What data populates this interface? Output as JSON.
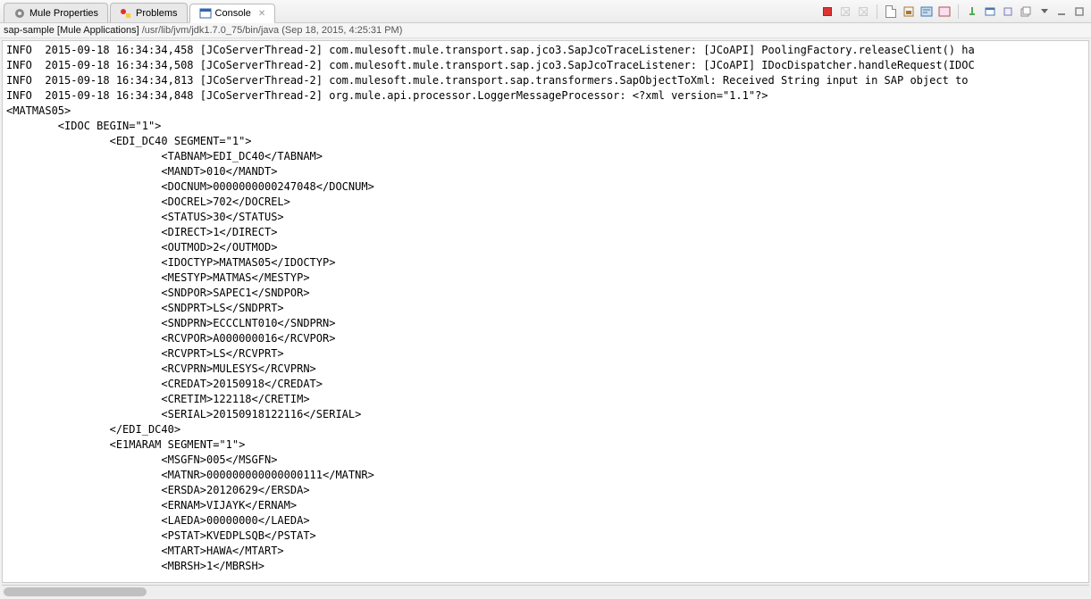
{
  "tabs": [
    {
      "label": "Mule Properties",
      "icon": "gear"
    },
    {
      "label": "Problems",
      "icon": "problems"
    },
    {
      "label": "Console",
      "icon": "console",
      "active": true,
      "closable": true
    }
  ],
  "launch": {
    "title": "sap-sample [Mule Applications]",
    "path": "/usr/lib/jvm/jdk1.7.0_75/bin/java",
    "timestamp": "(Sep 18, 2015, 4:25:31 PM)"
  },
  "log_lines": [
    "INFO  2015-09-18 16:34:34,458 [JCoServerThread-2] com.mulesoft.mule.transport.sap.jco3.SapJcoTraceListener: [JCoAPI] PoolingFactory.releaseClient() ha",
    "INFO  2015-09-18 16:34:34,508 [JCoServerThread-2] com.mulesoft.mule.transport.sap.jco3.SapJcoTraceListener: [JCoAPI] IDocDispatcher.handleRequest(IDOC",
    "INFO  2015-09-18 16:34:34,813 [JCoServerThread-2] com.mulesoft.mule.transport.sap.transformers.SapObjectToXml: Received String input in SAP object to ",
    "INFO  2015-09-18 16:34:34,848 [JCoServerThread-2] org.mule.api.processor.LoggerMessageProcessor: <?xml version=\"1.1\"?>"
  ],
  "xml_root": "<MATMAS05>",
  "xml_idoc_open": "        <IDOC BEGIN=\"1\">",
  "xml_edi_open": "                <EDI_DC40 SEGMENT=\"1\">",
  "xml_edi_fields": [
    "                        <TABNAM>EDI_DC40</TABNAM>",
    "                        <MANDT>010</MANDT>",
    "                        <DOCNUM>0000000000247048</DOCNUM>",
    "                        <DOCREL>702</DOCREL>",
    "                        <STATUS>30</STATUS>",
    "                        <DIRECT>1</DIRECT>",
    "                        <OUTMOD>2</OUTMOD>",
    "                        <IDOCTYP>MATMAS05</IDOCTYP>",
    "                        <MESTYP>MATMAS</MESTYP>",
    "                        <SNDPOR>SAPEC1</SNDPOR>",
    "                        <SNDPRT>LS</SNDPRT>",
    "                        <SNDPRN>ECCCLNT010</SNDPRN>",
    "                        <RCVPOR>A000000016</RCVPOR>",
    "                        <RCVPRT>LS</RCVPRT>",
    "                        <RCVPRN>MULESYS</RCVPRN>",
    "                        <CREDAT>20150918</CREDAT>",
    "                        <CRETIM>122118</CRETIM>",
    "                        <SERIAL>20150918122116</SERIAL>"
  ],
  "xml_edi_close": "                </EDI_DC40>",
  "xml_e1_open": "                <E1MARAM SEGMENT=\"1\">",
  "xml_e1_fields": [
    "                        <MSGFN>005</MSGFN>",
    "                        <MATNR>000000000000000111</MATNR>",
    "                        <ERSDA>20120629</ERSDA>",
    "                        <ERNAM>VIJAYK</ERNAM>",
    "                        <LAEDA>00000000</LAEDA>",
    "                        <PSTAT>KVEDPLSQB</PSTAT>",
    "                        <MTART>HAWA</MTART>",
    "                        <MBRSH>1</MBRSH>"
  ],
  "toolbar_icons": [
    {
      "name": "terminate-icon",
      "type": "stop",
      "disabled": false
    },
    {
      "name": "remove-terminated-icon",
      "type": "x",
      "disabled": true
    },
    {
      "name": "remove-all-terminated-icon",
      "type": "xx",
      "disabled": true
    },
    {
      "name": "sep"
    },
    {
      "name": "clear-console-icon",
      "type": "doc",
      "disabled": false
    },
    {
      "name": "scroll-lock-icon",
      "type": "lock",
      "disabled": false
    },
    {
      "name": "word-wrap-icon",
      "type": "wrap",
      "disabled": false
    },
    {
      "name": "show-console-icon",
      "type": "show",
      "disabled": false
    },
    {
      "name": "sep"
    },
    {
      "name": "pin-console-icon",
      "type": "pin",
      "disabled": false
    },
    {
      "name": "display-selected-icon",
      "type": "display",
      "disabled": false
    },
    {
      "name": "open-console-icon",
      "type": "open",
      "disabled": false
    },
    {
      "name": "new-console-icon",
      "type": "new",
      "disabled": false
    },
    {
      "name": "dropdown-icon",
      "type": "tri",
      "disabled": false
    },
    {
      "name": "minimize-icon",
      "type": "min",
      "disabled": false
    },
    {
      "name": "maximize-icon",
      "type": "max",
      "disabled": false
    }
  ]
}
